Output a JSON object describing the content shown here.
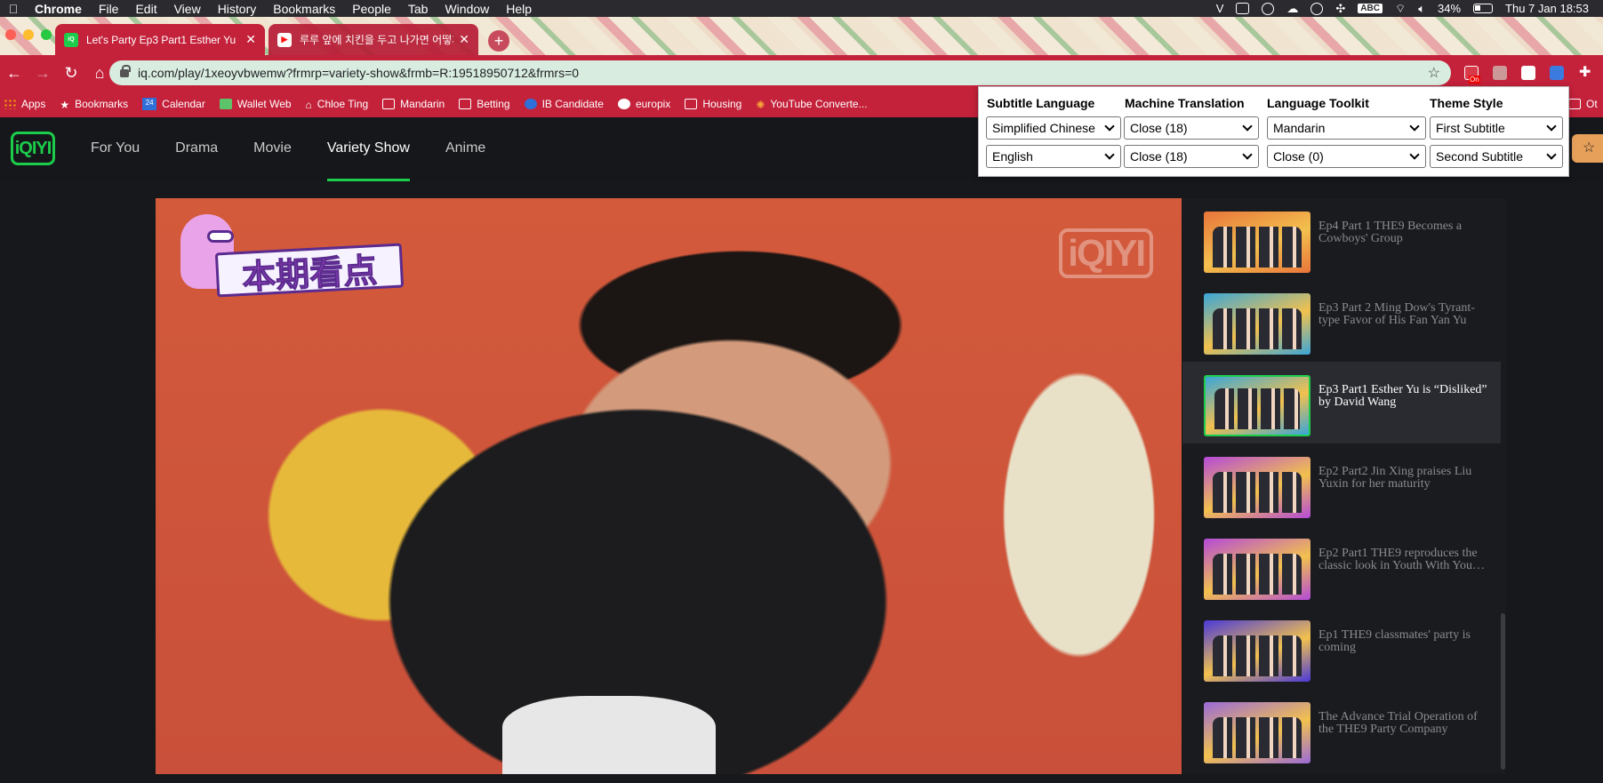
{
  "menubar": {
    "app": "Chrome",
    "items": [
      "File",
      "Edit",
      "View",
      "History",
      "Bookmarks",
      "People",
      "Tab",
      "Window",
      "Help"
    ],
    "keyboard": "ABC",
    "battery": "34%",
    "datetime": "Thu 7 Jan  18:53"
  },
  "tabs": [
    {
      "title": "Let's Party Ep3 Part1 Esther Yu",
      "favicon": "iqiyi-icon",
      "color": "#1ccc4b"
    },
    {
      "title": "루루 앞에 치킨을 두고 나가면 어떻게",
      "favicon": "youtube-icon",
      "color": "#ff0000"
    }
  ],
  "toolbar": {
    "url": "iq.com/play/1xeoyvbwemw?frmrp=variety-show&frmb=R:19518950712&frmrs=0",
    "extension_badge": "On"
  },
  "bookmarks": [
    {
      "label": "Apps",
      "icon": "apps-grid-icon"
    },
    {
      "label": "Bookmarks",
      "icon": "star-icon"
    },
    {
      "label": "Calendar",
      "icon": "calendar-icon",
      "badge": "24"
    },
    {
      "label": "Wallet Web",
      "icon": "wallet-icon"
    },
    {
      "label": "Chloe Ting",
      "icon": "home-icon"
    },
    {
      "label": "Mandarin",
      "icon": "folder-icon"
    },
    {
      "label": "Betting",
      "icon": "folder-icon"
    },
    {
      "label": "IB Candidate",
      "icon": "ib-icon"
    },
    {
      "label": "europix",
      "icon": "globe-icon"
    },
    {
      "label": "Housing",
      "icon": "folder-icon"
    },
    {
      "label": "YouTube Converte...",
      "icon": "converter-icon"
    }
  ],
  "bookmarks_overflow": "Ot",
  "site": {
    "logo": "iQIYI",
    "nav": [
      "For You",
      "Drama",
      "Movie",
      "Variety Show",
      "Anime"
    ],
    "active_nav": "Variety Show"
  },
  "subtitle_popup": {
    "headers": [
      "Subtitle Language",
      "Machine Translation",
      "Language Toolkit",
      "Theme Style"
    ],
    "row1": [
      "Simplified Chinese",
      "Close (18)",
      "Mandarin",
      "First Subtitle"
    ],
    "row2": [
      "English",
      "Close (18)",
      "Close (0)",
      "Second Subtitle"
    ]
  },
  "video": {
    "badge_text": "本期看点",
    "watermark": "iQIYI"
  },
  "episodes": [
    {
      "title": "Ep4 Part 1 THE9 Becomes a Cowboys' Group",
      "thumb_color": "#e9743a",
      "active": false
    },
    {
      "title": "Ep3 Part 2 Ming Dow's Tyrant-type Favor of His Fan Yan Yu",
      "thumb_color": "#3aa6d8",
      "active": false
    },
    {
      "title": "Ep3 Part1 Esther Yu is “Disliked” by David Wang",
      "thumb_color": "#3aa6d8",
      "active": true
    },
    {
      "title": "Ep2 Part2 Jin Xing praises Liu Yuxin for her maturity",
      "thumb_color": "#b44ad8",
      "active": false
    },
    {
      "title": "Ep2 Part1 THE9 reproduces the classic look in Youth With You…",
      "thumb_color": "#b44ad8",
      "active": false
    },
    {
      "title": "Ep1 THE9 classmates' party is coming",
      "thumb_color": "#4a3ad8",
      "active": false
    },
    {
      "title": "The Advance Trial Operation of the THE9 Party Company",
      "thumb_color": "#9a6ad8",
      "active": false
    }
  ]
}
